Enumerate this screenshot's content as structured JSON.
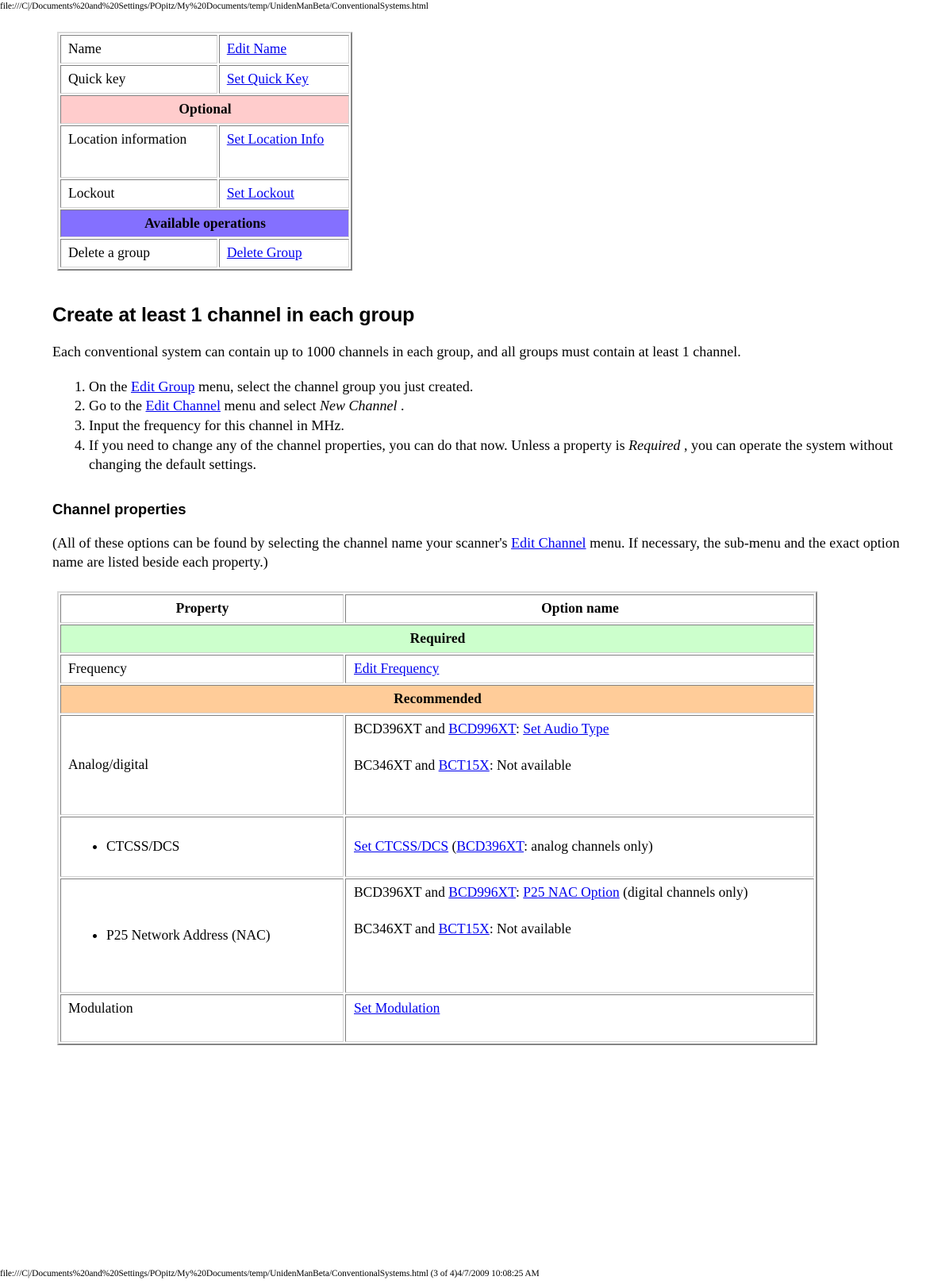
{
  "url_bar": {
    "top": "file:///C|/Documents%20and%20Settings/POpitz/My%20Documents/temp/UnidenManBeta/ConventionalSystems.html",
    "bottom": "file:///C|/Documents%20and%20Settings/POpitz/My%20Documents/temp/UnidenManBeta/ConventionalSystems.html (3 of 4)4/7/2009 10:08:25 AM"
  },
  "group_table": {
    "rows": [
      {
        "type": "data",
        "property": "Name",
        "option": "Edit Name",
        "option_is_link": true
      },
      {
        "type": "data",
        "property": "Quick key",
        "option": "Set Quick Key",
        "option_is_link": true
      },
      {
        "type": "section",
        "label": "Optional",
        "color": "#ffcccc"
      },
      {
        "type": "data",
        "property": "Location information",
        "option": "Set Location Info",
        "option_is_link": true
      },
      {
        "type": "data",
        "property": "Lockout",
        "option": "Set Lockout",
        "option_is_link": true
      },
      {
        "type": "section",
        "label": "Available operations",
        "color": "#8470ff"
      },
      {
        "type": "data",
        "property": "Delete a group",
        "option": "Delete Group",
        "option_is_link": true
      }
    ]
  },
  "headings": {
    "create_channel": "Create at least 1 channel in each group",
    "channel_properties": "Channel properties"
  },
  "paragraphs": {
    "intro": "Each conventional system can contain up to 1000 channels in each group, and all groups must contain at least 1 channel.",
    "channel_props_note_a": "(All of these options can be found by selecting the channel name your scanner's ",
    "channel_props_note_link": "Edit Channel",
    "channel_props_note_b": " menu. If necessary, the sub-menu and the exact option name are listed beside each property.)"
  },
  "steps": [
    {
      "before": "On the ",
      "link": "Edit Group",
      "after": " menu, select the channel group you just created."
    },
    {
      "before": "Go to the ",
      "link": "Edit Channel",
      "after": " menu and select ",
      "italic": "New Channel",
      "tail": " ."
    },
    {
      "before": "Input the frequency for this channel in MHz.",
      "link": "",
      "after": ""
    },
    {
      "before": "If you need to change any of the channel properties, you can do that now. Unless a property is ",
      "italic": "Required",
      "tail": " , you can operate the system without changing the default settings."
    }
  ],
  "channel_table": {
    "header": {
      "property": "Property",
      "option": "Option name"
    },
    "sections": {
      "required": {
        "label": "Required",
        "color": "#ccffcc"
      },
      "recommended": {
        "label": "Recommended",
        "color": "#ffcc99"
      }
    },
    "rows": {
      "frequency": {
        "property": "Frequency",
        "option": "Edit Frequency"
      },
      "analog_digital": {
        "property": "Analog/digital",
        "line1_a": "BCD396XT and ",
        "line1_link1": "BCD996XT",
        "line1_b": ": ",
        "line1_link2": "Set Audio Type",
        "line2_a": "BC346XT and ",
        "line2_link": "BCT15X",
        "line2_b": ": Not available"
      },
      "ctcss_dcs": {
        "property": "CTCSS/DCS",
        "link1": "Set CTCSS/DCS",
        "mid": " (",
        "link2": "BCD396XT",
        "tail": ": analog channels only)"
      },
      "p25_nac": {
        "property": "P25 Network Address (NAC)",
        "line1_a": "BCD396XT and ",
        "line1_link1": "BCD996XT",
        "line1_b": ": ",
        "line1_link2": "P25 NAC Option",
        "line1_c": " (digital channels only)",
        "line2_a": "BC346XT and ",
        "line2_link": "BCT15X",
        "line2_b": ": Not available"
      },
      "modulation": {
        "property": "Modulation",
        "option": "Set Modulation"
      }
    }
  },
  "colors": {
    "link": "#0000ee",
    "optional_section": "#ffcccc",
    "available_ops_section": "#8470ff",
    "required_section": "#ccffcc",
    "recommended_section": "#ffcc99"
  }
}
